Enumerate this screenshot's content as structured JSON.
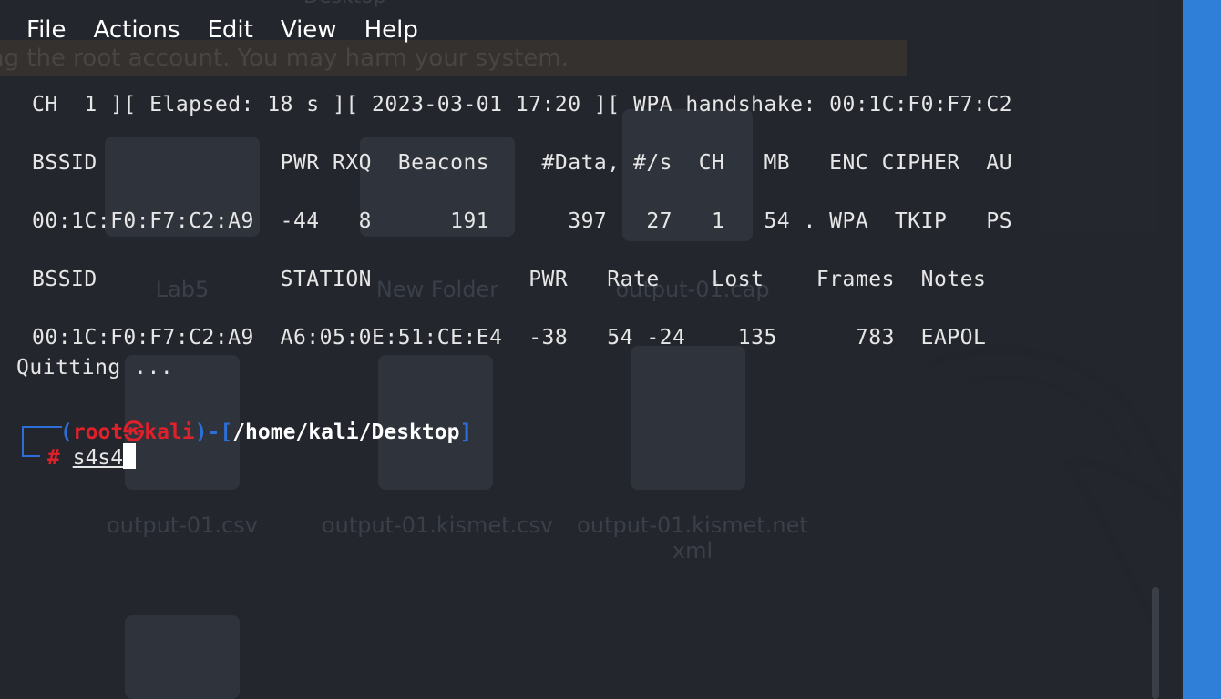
{
  "menu": [
    "File",
    "Actions",
    "Edit",
    "View",
    "Help"
  ],
  "warning_text": "ng the root account. You may harm your system.",
  "behind_window_title": "Desktop",
  "desktop_icons": [
    "Lab5",
    "New Folder",
    "output-01.cap",
    "output-01.csv",
    "output-01.kismet.csv",
    "output-01.kismet.netxml"
  ],
  "terminal": {
    "status": "CH  1 ][ Elapsed: 18 s ][ 2023-03-01 17:20 ][ WPA handshake: 00:1C:F0:F7:C2",
    "ap_header": "BSSID              PWR RXQ  Beacons    #Data, #/s  CH   MB   ENC CIPHER  AU",
    "ap_row": "00:1C:F0:F7:C2:A9  -44   8      191      397   27   1   54 . WPA  TKIP   PS",
    "st_header": "BSSID              STATION            PWR   Rate    Lost    Frames  Notes",
    "st_row": "00:1C:F0:F7:C2:A9  A6:05:0E:51:CE:E4  -38   54 -24    135      783  EAPOL",
    "quit": "Quitting ...",
    "prompt_user": "root",
    "prompt_symbol": "㉿",
    "prompt_host": "kali",
    "prompt_path": "/home/kali/Desktop",
    "prompt_hash": "#",
    "command": "s4s4"
  },
  "colors": {
    "prompt_red": "#e0202a",
    "prompt_blue": "#2d6fd6",
    "terminal_bg": "#23262d",
    "sidebar_blue": "#2f7fd8"
  }
}
